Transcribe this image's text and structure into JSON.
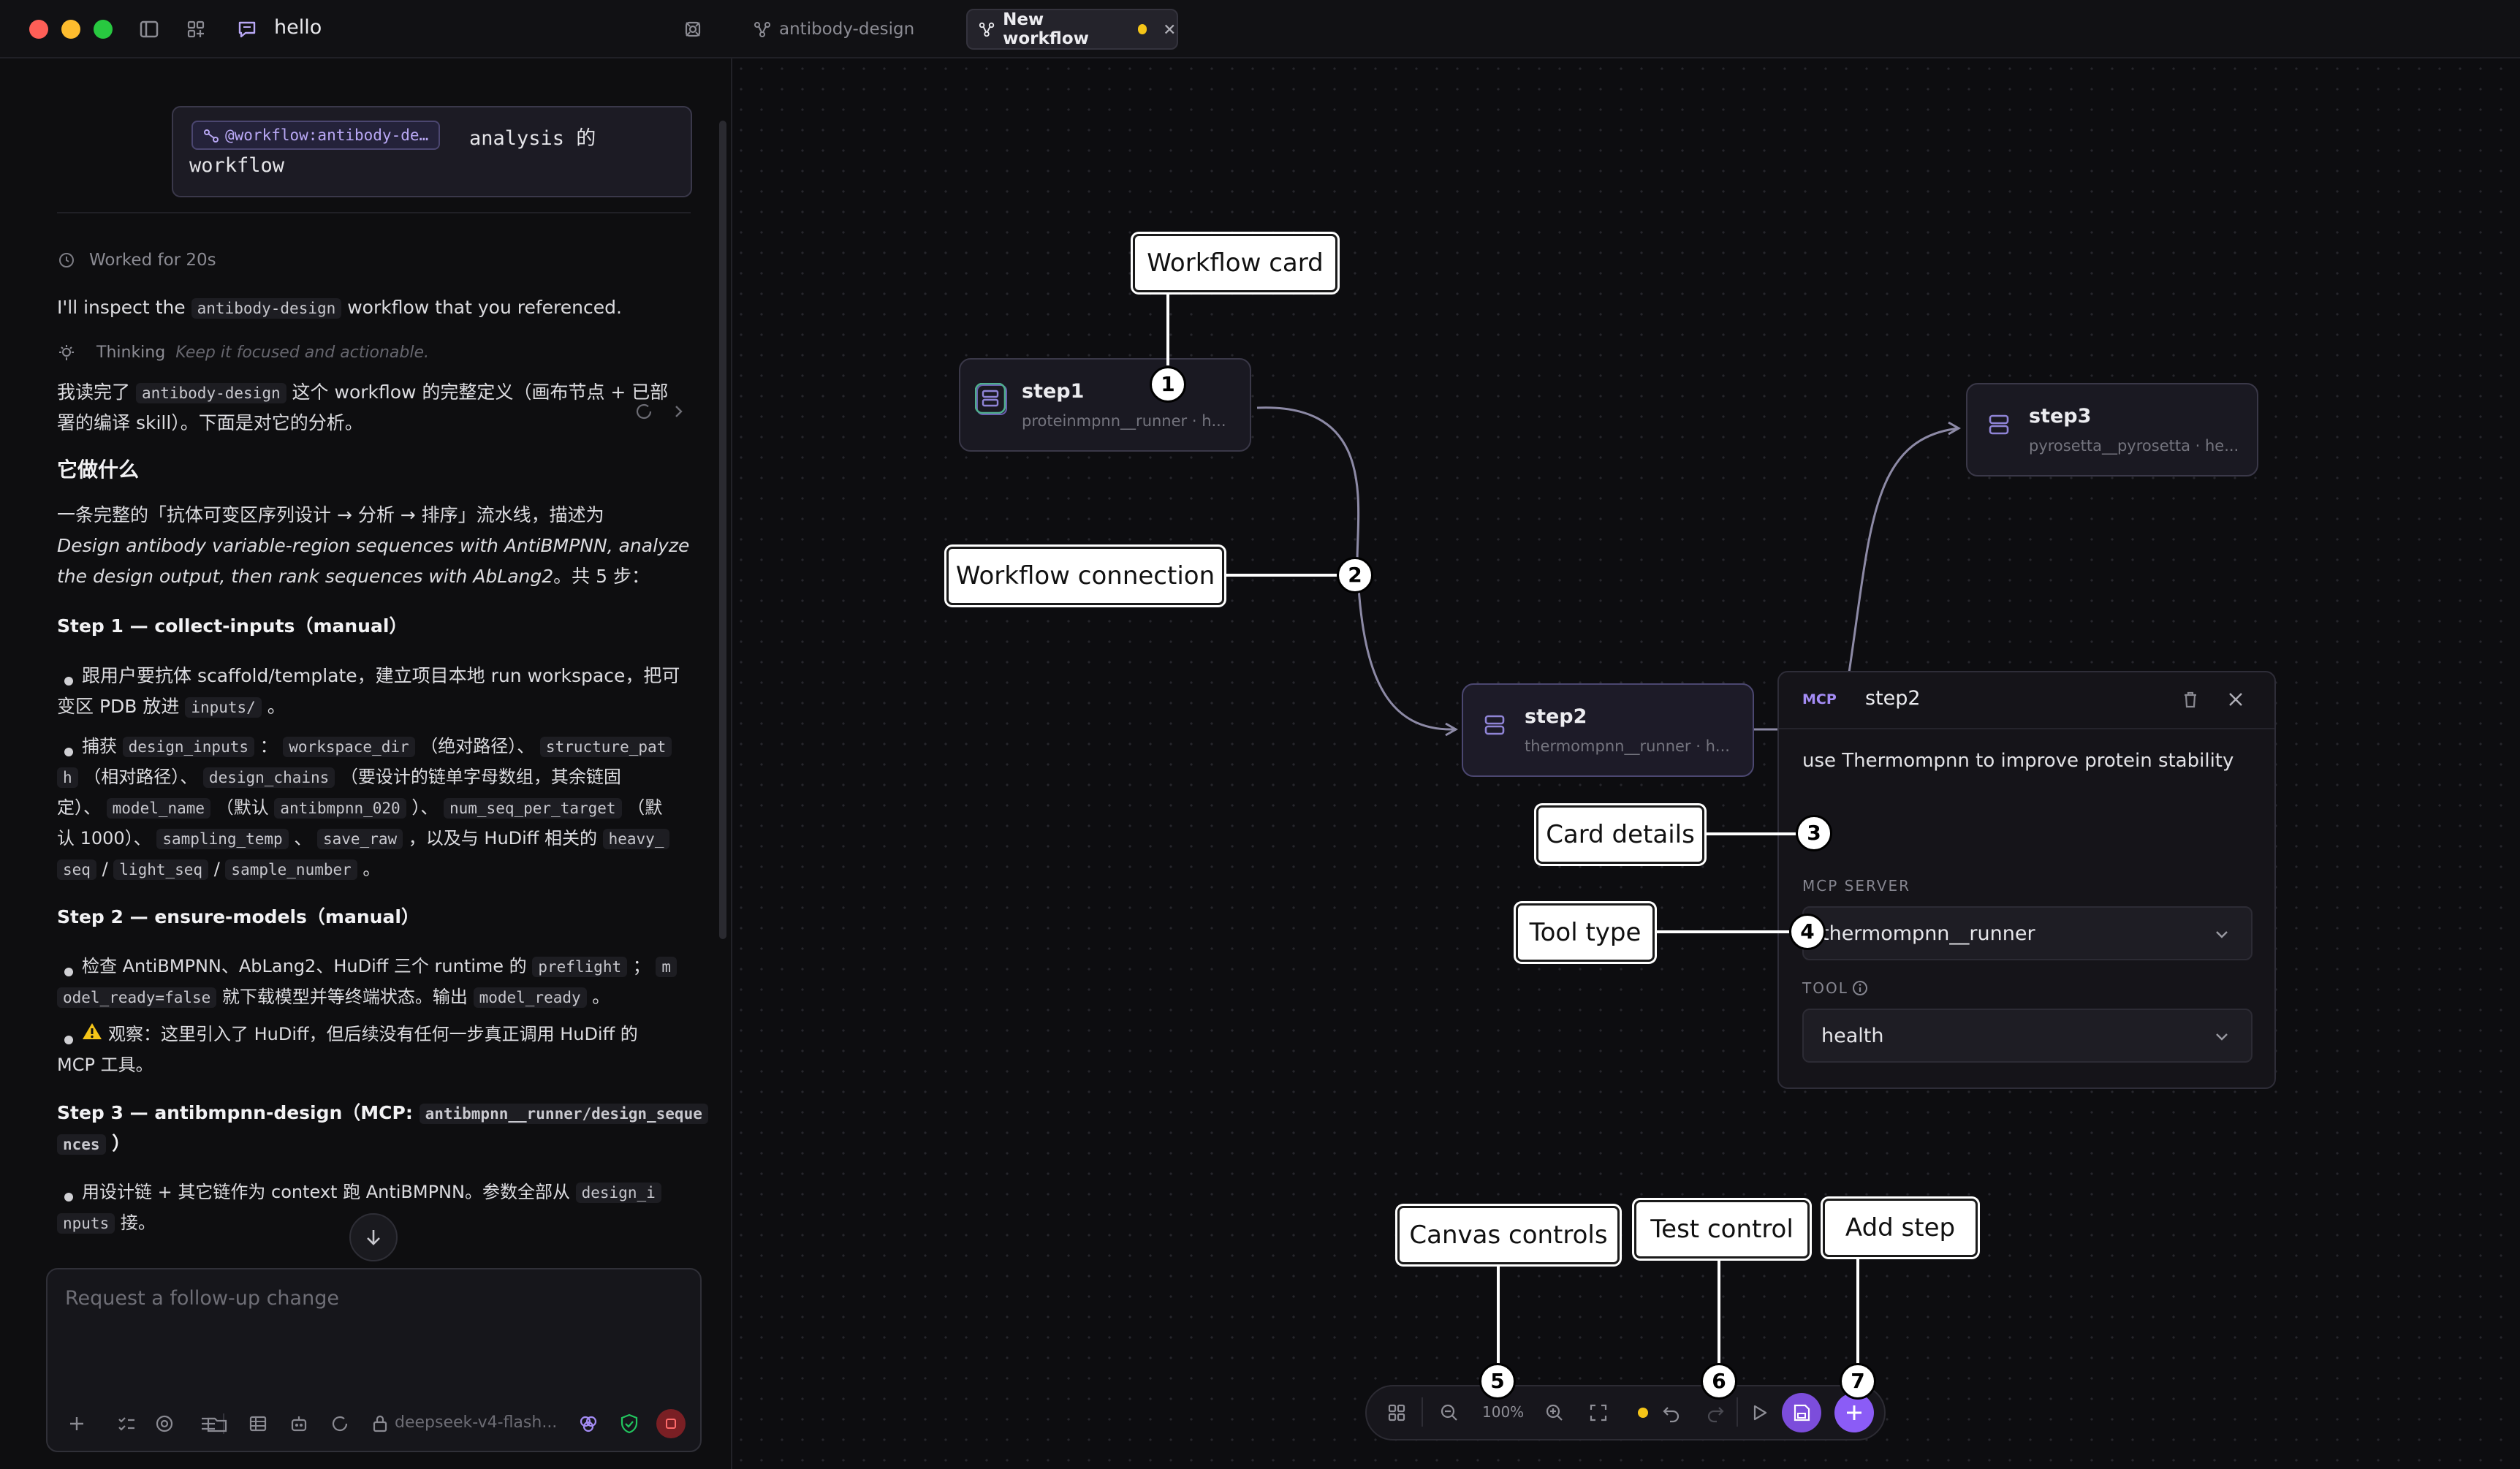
{
  "window": {
    "chat_title": "hello",
    "tabs": [
      {
        "label": "antibody-design",
        "active": false
      },
      {
        "label": "New workflow",
        "active": true
      }
    ]
  },
  "chat": {
    "user_message": {
      "workflow_chip": "@workflow:antibody-de…",
      "text_1": "analysis 的",
      "text_2": "workflow"
    },
    "worked_for": "Worked for 20s",
    "intro": {
      "pre": "I'll inspect the ",
      "code": "antibody-design",
      "post": " workflow that you referenced."
    },
    "thinking": {
      "label": "Thinking",
      "detail": "Keep it focused and actionable."
    },
    "p1": {
      "pre": "我读完了 ",
      "code": "antibody-design",
      "post": " 这个 workflow 的完整定义（画布节点 + 已部",
      "line2": "署的编译 skill）。下面是对它的分析。"
    },
    "h_what": "它做什么",
    "p2": {
      "line1": "一条完整的「抗体可变区序列设计 → 分析 → 排序」流水线，描述为",
      "line2": "Design antibody variable-region sequences with AntiBMPNN, analyze",
      "line3": "the design output, then rank sequences with AbLang2",
      "line3_post": "。共 5 步："
    },
    "step1": {
      "title": "Step 1 — collect-inputs（manual）",
      "b1_l1": "跟用户要抗体 scaffold/template，建立项目本地 run workspace，把可",
      "b1_l2_pre": "变区 PDB 放进 ",
      "b1_l2_code": "inputs/",
      "b1_l2_post": " 。",
      "b2_l1_pre": "捕获 ",
      "b2_l1_c1": "design_inputs",
      "b2_l1_m1": " ： ",
      "b2_l1_c2": "workspace_dir",
      "b2_l1_m2": " （绝对路径）、 ",
      "b2_l1_c3": "structure_pat",
      "b2_l2_c1": "h",
      "b2_l2_m1": " （相对路径）、 ",
      "b2_l2_c2": "design_chains",
      "b2_l2_m2": " （要设计的链单字母数组，其余链固",
      "b2_l3_m0": "定）、 ",
      "b2_l3_c1": "model_name",
      "b2_l3_m1": " （默认 ",
      "b2_l3_c2": "antibmpnn_020",
      "b2_l3_m2": " ）、 ",
      "b2_l3_c3": "num_seq_per_target",
      "b2_l3_m3": " （默",
      "b2_l4_m0": "认 1000）、 ",
      "b2_l4_c1": "sampling_temp",
      "b2_l4_m1": " 、 ",
      "b2_l4_c2": "save_raw",
      "b2_l4_m2": " ，以及与 HuDiff 相关的 ",
      "b2_l4_c3": "heavy_",
      "b2_l5_c1": "seq",
      "b2_l5_m1": " / ",
      "b2_l5_c2": "light_seq",
      "b2_l5_m2": " / ",
      "b2_l5_c3": "sample_number",
      "b2_l5_m3": " 。"
    },
    "step2": {
      "title": "Step 2 — ensure-models（manual）",
      "b1_l1_pre": "检查 AntiBMPNN、AbLang2、HuDiff 三个 runtime 的 ",
      "b1_l1_c1": "preflight",
      "b1_l1_m1": " ； ",
      "b1_l1_c2": "m",
      "b1_l2_c1": "odel_ready=false",
      "b1_l2_m1": " 就下载模型并等终端状态。输出 ",
      "b1_l2_c2": "model_ready",
      "b1_l2_m2": " 。",
      "b2_l1": "观察：这里引入了 HuDiff，但后续没有任何一步真正调用 HuDiff 的",
      "b2_l2": "MCP 工具。"
    },
    "step3": {
      "title_pre": "Step 3 — antibmpnn-design（MCP: ",
      "title_code": "antibmpnn__runner/design_seque",
      "title_l2_code": "nces",
      "title_l2_post": " ）",
      "b1_l1_pre": "用设计链 + 其它链作为 context 跑 AntiBMPNN。参数全部从 ",
      "b1_l1_code": "design_i",
      "b1_l2_code": "nputs",
      "b1_l2_post": " 接。"
    },
    "composer": {
      "placeholder": "Request a follow-up change",
      "model": "deepseek-v4-flash..."
    }
  },
  "canvas": {
    "nodes": [
      {
        "id": "step1",
        "title": "step1",
        "subtitle": "proteinmpnn__runner · h..."
      },
      {
        "id": "step2",
        "title": "step2",
        "subtitle": "thermompnn__runner · h..."
      },
      {
        "id": "step3",
        "title": "step3",
        "subtitle": "pyrosetta__pyrosetta · he..."
      }
    ],
    "detail": {
      "badge": "MCP",
      "title": "step2",
      "description": "use Thermompnn to improve protein stability",
      "server_label": "MCP SERVER",
      "server_value": "thermompnn__runner",
      "tool_label": "TOOL",
      "tool_value": "health"
    },
    "toolbar": {
      "zoom": "100%"
    },
    "callouts": [
      {
        "n": "1",
        "label": "Workflow card"
      },
      {
        "n": "2",
        "label": "Workflow connection"
      },
      {
        "n": "3",
        "label": "Card details"
      },
      {
        "n": "4",
        "label": "Tool type"
      },
      {
        "n": "5",
        "label": "Canvas controls"
      },
      {
        "n": "6",
        "label": "Test control"
      },
      {
        "n": "7",
        "label": "Add step"
      }
    ]
  },
  "colors": {
    "accent": "#8b5cf6",
    "unsaved_dot": "#f5c518",
    "traffic_red": "#ff5f57",
    "traffic_yellow": "#febc2e",
    "traffic_green": "#28c840"
  }
}
